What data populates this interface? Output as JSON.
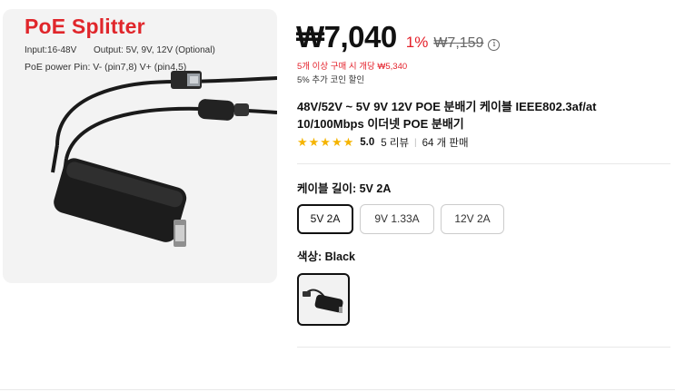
{
  "image": {
    "title": "PoE Splitter",
    "spec_input": "Input:16-48V",
    "spec_output": "Output: 5V, 9V, 12V (Optional)",
    "spec_pins": "PoE power Pin: V- (pin7,8)  V+ (pin4,5)"
  },
  "price": {
    "current": "₩7,040",
    "discount": "1%",
    "original": "₩7,159",
    "info_icon": "i",
    "bulk_note": "5개 이상 구매 시 개당 ₩5,340",
    "coin_note": "5% 추가 코인 할인"
  },
  "product": {
    "title": "48V/52V ~ 5V 9V 12V POE 분배기 케이블 IEEE802.3af/at 10/100Mbps 이더넷 POE 분배기",
    "stars": "★★★★★",
    "rating": "5.0",
    "reviews": "5 리뷰",
    "separator": "|",
    "sold": "64 개 판매"
  },
  "options": {
    "length_label": "케이블 길이: 5V 2A",
    "length_choices": [
      "5V 2A",
      "9V 1.33A",
      "12V 2A"
    ],
    "selected_length": "5V 2A",
    "color_label": "색상: Black",
    "selected_color": "Black"
  },
  "colors": {
    "price_red": "#e4202a",
    "title_red": "#e0262b",
    "star": "#f5b400",
    "selected_border": "#111111"
  }
}
